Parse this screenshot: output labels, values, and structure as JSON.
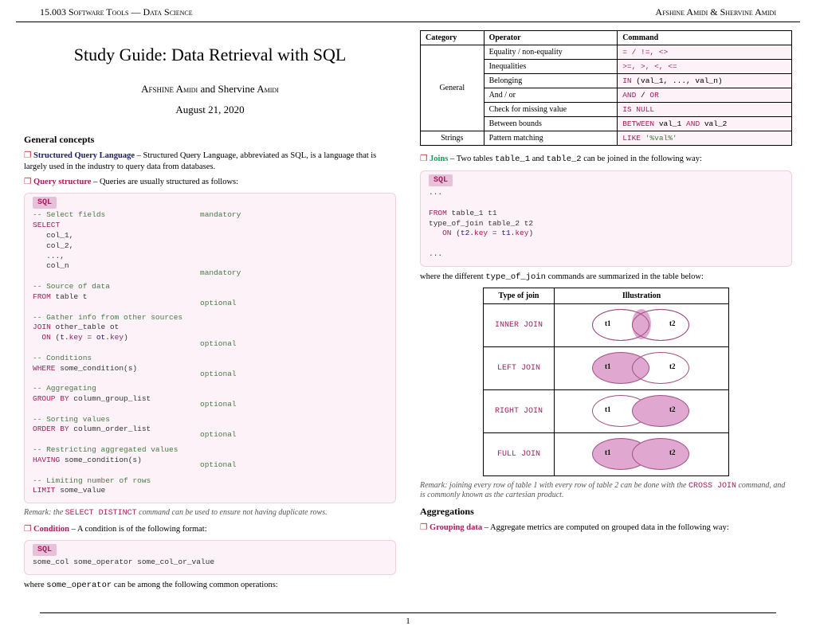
{
  "header": {
    "left": "15.003 Software Tools — Data Science",
    "right": "Afshine Amidi & Shervine Amidi"
  },
  "title": "Study Guide: Data Retrieval with SQL",
  "author": "Afshine Amidi and Shervine Amidi",
  "authorSC_1": "Afshine A",
  "authorSC_2": "midi",
  "authorSC_3": " and Shervine A",
  "authorSC_4": "midi",
  "date": "August 21, 2020",
  "sec1": "General concepts",
  "def_sql_term": "Structured Query Language",
  "def_sql_body": " – Structured Query Language, abbreviated as SQL, is a language that is largely used in the industry to query data from databases.",
  "def_qs_term": "Query structure",
  "def_qs_body": " – Queries are usually structured as follows:",
  "sql_label": "SQL",
  "code1": {
    "c1": "-- Select fields",
    "a1": "mandatory",
    "k1": "SELECT",
    "l2": "   col_1,\n   col_2,\n   ...,\n   col_n",
    "c2": "-- Source of data",
    "a2": "mandatory",
    "k2": "FROM",
    "v2": " table t",
    "c3": "-- Gather info from other sources",
    "a3": "optional",
    "k3": "JOIN",
    "v3": " other_table ot",
    "k3b": "  ON",
    "v3b": " (",
    "v3c": "t",
    "v3d": ".",
    "v3e": "key",
    "v3f": " = ",
    "v3g": "ot",
    "v3h": ".",
    "v3i": "key",
    "v3j": ")",
    "c4": "-- Conditions",
    "a4": "optional",
    "k4": "WHERE",
    "v4": " some_condition(s)",
    "c5": "-- Aggregating",
    "a5": "optional",
    "k5": "GROUP BY",
    "v5": " column_group_list",
    "c6": "-- Sorting values",
    "a6": "optional",
    "k6": "ORDER BY",
    "v6": " column_order_list",
    "c7": "-- Restricting aggregated values",
    "a7": "optional",
    "k7": "HAVING",
    "v7": " some_condition(s)",
    "c8": "-- Limiting number of rows",
    "a8": "optional",
    "k8": "LIMIT",
    "v8": " some_value"
  },
  "remark1_a": "Remark: the ",
  "remark1_b": "SELECT DISTINCT",
  "remark1_c": " command can be used to ensure not having duplicate rows.",
  "def_cond_term": "Condition",
  "def_cond_body": " – A condition is of the following format:",
  "code2": "some_col some_operator some_col_or_value",
  "cond_tail_a": "where ",
  "cond_tail_b": "some_operator",
  "cond_tail_c": " can be among the following common operations:",
  "optable": {
    "h": [
      "Category",
      "Operator",
      "Command"
    ],
    "rows": [
      {
        "cat": "General",
        "rowspan": 6,
        "op": "Equality / non-equality",
        "cmd": "= / !=, <>"
      },
      {
        "op": "Inequalities",
        "cmd": ">=, >, <, <="
      },
      {
        "op": "Belonging",
        "cmd_a": "IN",
        "cmd_b": " (val_1, ..., val_n)"
      },
      {
        "op": "And / or",
        "cmd": "AND / OR"
      },
      {
        "op": "Check for missing value",
        "cmd": "IS NULL"
      },
      {
        "op": "Between bounds",
        "cmd_a": "BETWEEN",
        "cmd_b": " val_1 ",
        "cmd_c": "AND",
        "cmd_d": " val_2"
      },
      {
        "cat": "Strings",
        "rowspan": 1,
        "op": "Pattern matching",
        "cmd_a": "LIKE",
        "cmd_b": " '%val%'"
      }
    ]
  },
  "def_joins_term": "Joins",
  "def_joins_a": " – Two tables ",
  "def_joins_b": "table_1",
  "def_joins_c": " and ",
  "def_joins_d": "table_2",
  "def_joins_e": " can be joined in the following way:",
  "code3": {
    "l0": "...",
    "k1": "FROM",
    "v1": " table_1 t1",
    "l2": "type_of_join table_2 t2",
    "k3": "   ON",
    "v3a": " (",
    "v3b": "t2",
    "v3c": ".",
    "v3d": "key",
    "v3e": " = ",
    "v3f": "t1",
    "v3g": ".",
    "v3h": "key",
    "v3i": ")",
    "l4": "..."
  },
  "joins_tail_a": "where the different ",
  "joins_tail_b": "type_of_join",
  "joins_tail_c": " commands are summarized in the table below:",
  "jointable": {
    "h": [
      "Type of join",
      "Illustration"
    ],
    "rows": [
      "INNER JOIN",
      "LEFT JOIN",
      "RIGHT JOIN",
      "FULL JOIN"
    ],
    "t1": "t1",
    "t2": "t2"
  },
  "remark2_a": "Remark: joining every row of table 1 with every row of table 2 can be done with the ",
  "remark2_b": "CROSS JOIN",
  "remark2_c": " command, and is commonly known as the cartesian product.",
  "sec2": "Aggregations",
  "def_grp_term": "Grouping data",
  "def_grp_body": " – Aggregate metrics are computed on grouped data in the following way:",
  "pageno": "1"
}
